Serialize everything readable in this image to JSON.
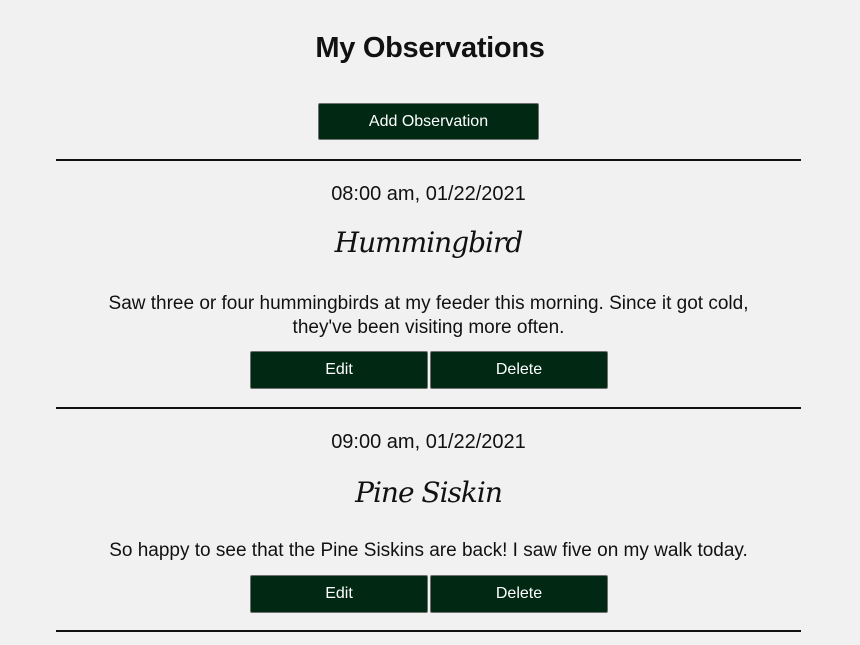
{
  "page": {
    "title": "My Observations",
    "add_button_label": "Add Observation"
  },
  "observations": [
    {
      "time": "08:00 am, 01/22/2021",
      "species": "Hummingbird",
      "notes": "Saw three or four hummingbirds at my feeder this morning. Since it got cold, they've been visiting more often.",
      "edit_label": "Edit",
      "delete_label": "Delete"
    },
    {
      "time": "09:00 am, 01/22/2021",
      "species": "Pine Siskin",
      "notes": "So happy to see that the Pine Siskins are back! I saw five on my walk today.",
      "edit_label": "Edit",
      "delete_label": "Delete"
    }
  ],
  "colors": {
    "background": "#f1f1f1",
    "button_bg": "#012813",
    "button_text": "#ffffff",
    "divider": "#111111"
  }
}
